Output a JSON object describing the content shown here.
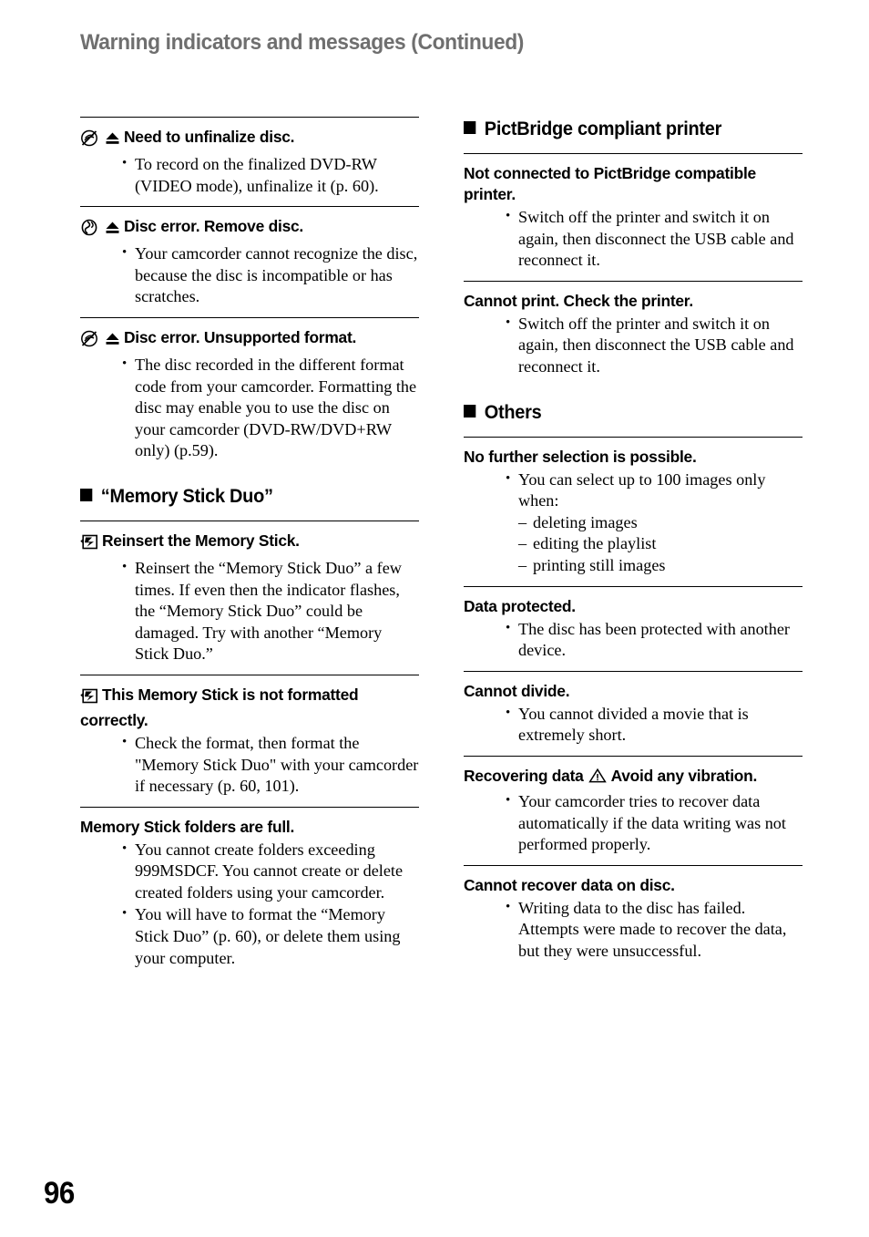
{
  "page": {
    "title": "Warning indicators and messages (Continued)",
    "number": "96",
    "title_color": "#6f6f6f",
    "text_color": "#000000"
  },
  "left_column": {
    "entries": [
      {
        "icons": [
          "disc-no-icon",
          "eject-icon"
        ],
        "heading": "Need to unfinalize disc.",
        "bullets": [
          "To record on the finalized DVD-RW (VIDEO mode), unfinalize it (p. 60)."
        ]
      },
      {
        "icons": [
          "disc-flash-icon",
          "eject-icon"
        ],
        "heading": "Disc error. Remove disc.",
        "bullets": [
          "Your camcorder cannot recognize the disc, because the disc is incompatible or has scratches."
        ]
      },
      {
        "icons": [
          "disc-no-icon",
          "eject-icon"
        ],
        "heading": "Disc error. Unsupported format.",
        "bullets": [
          "The disc recorded in the different format code from your camcorder. Formatting the disc may enable you to use the disc on your camcorder (DVD-RW/DVD+RW only) (p.59)."
        ]
      }
    ],
    "section": {
      "label": "“Memory Stick Duo”",
      "bullet_icon": "black-square-icon",
      "entries": [
        {
          "icons": [
            "memory-stick-icon"
          ],
          "heading": "Reinsert the Memory Stick.",
          "bullets": [
            "Reinsert the “Memory Stick Duo” a few times. If even then the indicator flashes, the “Memory Stick Duo” could be damaged. Try with another “Memory Stick Duo.”"
          ]
        },
        {
          "icons": [
            "memory-stick-icon"
          ],
          "heading": "This Memory Stick is not formatted correctly.",
          "bullets": [
            "Check the format, then format the \"Memory Stick Duo\" with your camcorder if necessary (p. 60, 101)."
          ]
        },
        {
          "icons": [],
          "heading": "Memory Stick folders are full.",
          "bullets": [
            "You cannot create folders exceeding 999MSDCF. You cannot create or delete created folders using your camcorder.",
            "You will have to format the “Memory Stick Duo” (p. 60), or delete them using your computer."
          ]
        }
      ]
    }
  },
  "right_column": {
    "sections": [
      {
        "label": "PictBridge compliant printer",
        "bullet_icon": "black-square-icon",
        "entries": [
          {
            "heading": "Not connected to PictBridge compatible printer.",
            "bullets": [
              "Switch off the printer and switch it on again, then disconnect the USB cable and reconnect it."
            ]
          },
          {
            "heading": "Cannot print. Check the printer.",
            "bullets": [
              "Switch off the printer and switch it on again, then disconnect the USB cable and reconnect it."
            ]
          }
        ]
      },
      {
        "label": "Others",
        "bullet_icon": "black-square-icon",
        "entries": [
          {
            "heading": "No further selection is possible.",
            "bullets": [
              "You can select up to 100 images only when:"
            ],
            "sub_bullets": [
              "deleting images",
              "editing the playlist",
              "printing still images"
            ]
          },
          {
            "heading": "Data protected.",
            "bullets": [
              "The disc has been protected with another device."
            ]
          },
          {
            "heading": "Cannot divide.",
            "bullets": [
              "You cannot divided a movie that is extremely short."
            ]
          },
          {
            "heading_part1": "Recovering data",
            "heading_icon": "warning-triangle-icon",
            "heading_part2": "Avoid any vibration.",
            "bullets": [
              "Your camcorder tries to recover data automatically if the data writing was not performed properly."
            ]
          },
          {
            "heading": "Cannot recover data on disc.",
            "bullets": [
              "Writing data to the disc has failed. Attempts were made to recover the data, but they were unsuccessful."
            ]
          }
        ]
      }
    ]
  }
}
